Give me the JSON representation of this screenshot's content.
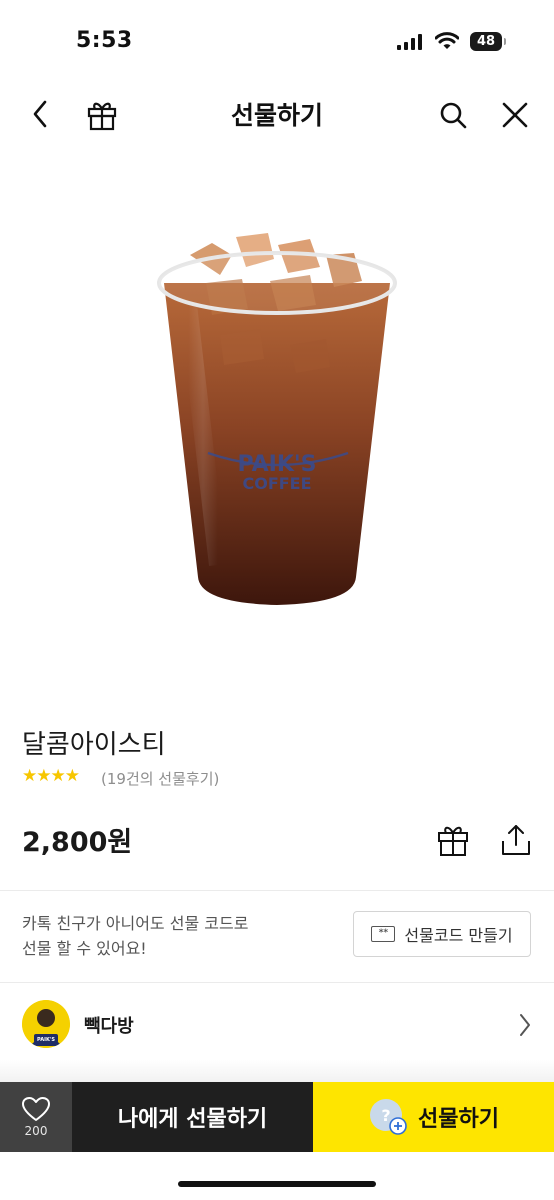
{
  "status_bar": {
    "time": "5:53",
    "battery": "48"
  },
  "header": {
    "title": "선물하기"
  },
  "product": {
    "cup_text_line1": "PAIK'S",
    "cup_text_line2": "COFFEE",
    "name": "달콤아이스티",
    "rating_stars": "★★★★",
    "review_text": "(19건의 선물후기)",
    "price": "2,800원"
  },
  "promo": {
    "text": "카톡 친구가 아니어도 선물 코드로\n선물 할 수 있어요!",
    "code_icon_text": "**",
    "code_button_label": "선물코드 만들기"
  },
  "brand": {
    "name": "빽다방",
    "logo_text": "PAIK'S"
  },
  "bottom_bar": {
    "like_count": "200",
    "self_gift_label": "나에게 선물하기",
    "gift_label": "선물하기",
    "gift_icon_glyph": "?"
  },
  "colors": {
    "accent_yellow": "#FEE500",
    "dark_button": "#1F1F1F",
    "like_button": "#414141",
    "star": "#F7C600"
  }
}
